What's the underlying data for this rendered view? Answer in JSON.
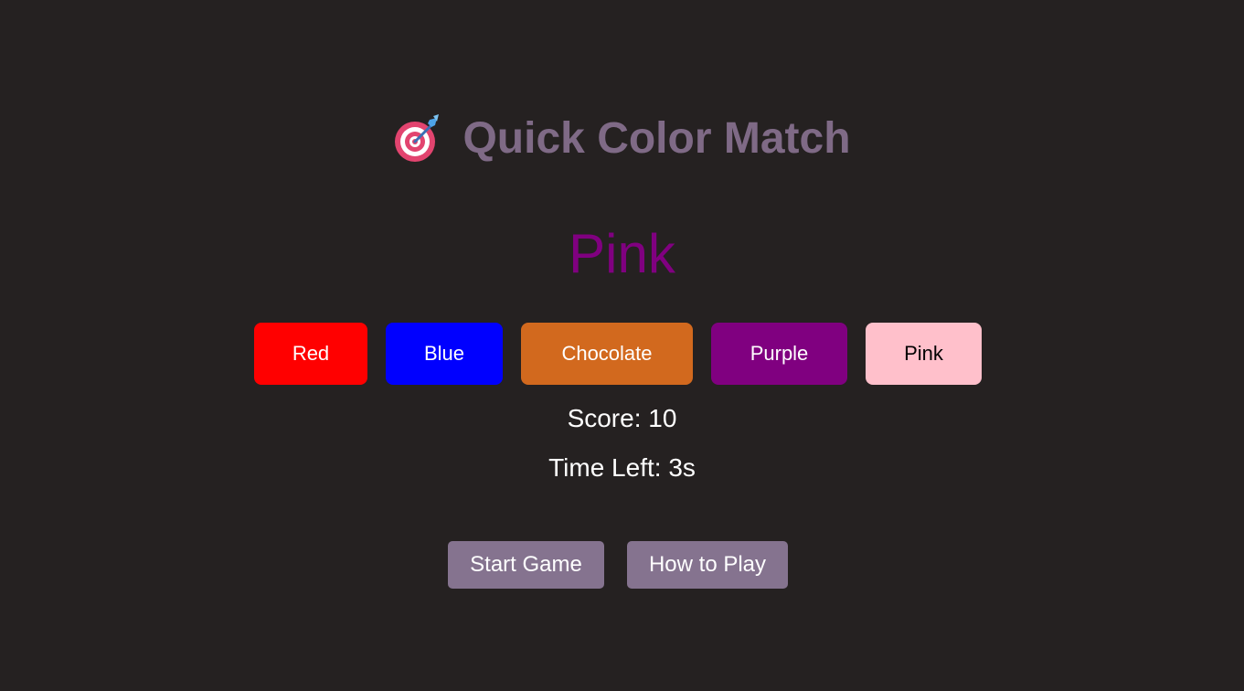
{
  "header": {
    "icon": "dart-target-icon",
    "title": "Quick Color Match",
    "title_color": "#7f6a86"
  },
  "game": {
    "target_word": "Pink",
    "target_word_color": "#800080",
    "color_buttons": [
      {
        "label": "Red",
        "color": "#ff0000"
      },
      {
        "label": "Blue",
        "color": "#0000ff"
      },
      {
        "label": "Chocolate",
        "color": "#d2691e"
      },
      {
        "label": "Purple",
        "color": "#800080"
      },
      {
        "label": "Pink",
        "color": "#ffc0cb"
      }
    ],
    "score_text": "Score: 10",
    "time_left_text": "Time Left: 3s"
  },
  "controls": {
    "start_label": "Start Game",
    "how_to_label": "How to Play",
    "button_color": "#85738f"
  },
  "theme": {
    "background": "#252121"
  }
}
